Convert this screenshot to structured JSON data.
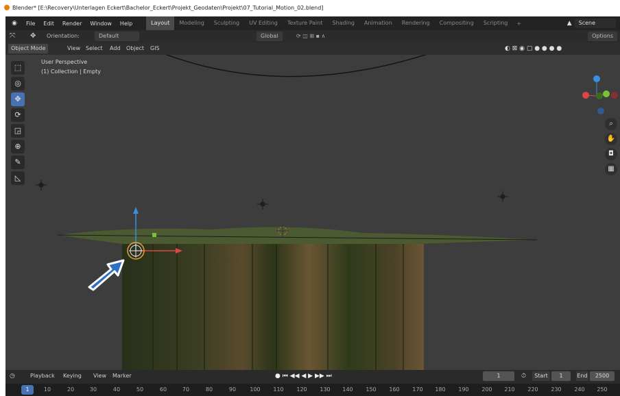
{
  "window": {
    "title": "Blender* [E:\\Recovery\\Unterlagen Eckert\\Bachelor_Eckert\\Projekt_Geodaten\\Projekt\\07_Tutorial_Motion_02.blend]"
  },
  "menu": {
    "items": [
      "File",
      "Edit",
      "Render",
      "Window",
      "Help"
    ]
  },
  "workspaces": {
    "tabs": [
      "Layout",
      "Modeling",
      "Sculpting",
      "UV Editing",
      "Texture Paint",
      "Shading",
      "Animation",
      "Rendering",
      "Compositing",
      "Scripting"
    ],
    "active": "Layout"
  },
  "scene": {
    "name": "Scene"
  },
  "header": {
    "orientation_label": "Orientation:",
    "orientation_value": "Default",
    "transform_orientation": "Global",
    "options": "Options"
  },
  "viewport_header": {
    "mode": "Object Mode",
    "menus": [
      "View",
      "Select",
      "Add",
      "Object",
      "GIS"
    ]
  },
  "viewport": {
    "perspective": "User Perspective",
    "collection": "(1) Collection | Empty"
  },
  "timeline": {
    "menus": [
      "Playback",
      "Keying",
      "View",
      "Marker"
    ],
    "current_frame": "1",
    "start_label": "Start",
    "start_value": "1",
    "end_label": "End",
    "end_value": "2500",
    "ticks": [
      "1",
      "10",
      "20",
      "30",
      "40",
      "50",
      "60",
      "70",
      "80",
      "90",
      "100",
      "110",
      "120",
      "130",
      "140",
      "150",
      "160",
      "170",
      "180",
      "190",
      "200",
      "210",
      "220",
      "230",
      "240",
      "250"
    ]
  },
  "colors": {
    "active_tab": "#4a4a4a",
    "accent": "#4772b3",
    "axis_x": "#e04646",
    "axis_y": "#7ac03a",
    "axis_z": "#3b8fe0",
    "cursor": "#e8a040",
    "arrow": "#2f6fc6"
  }
}
